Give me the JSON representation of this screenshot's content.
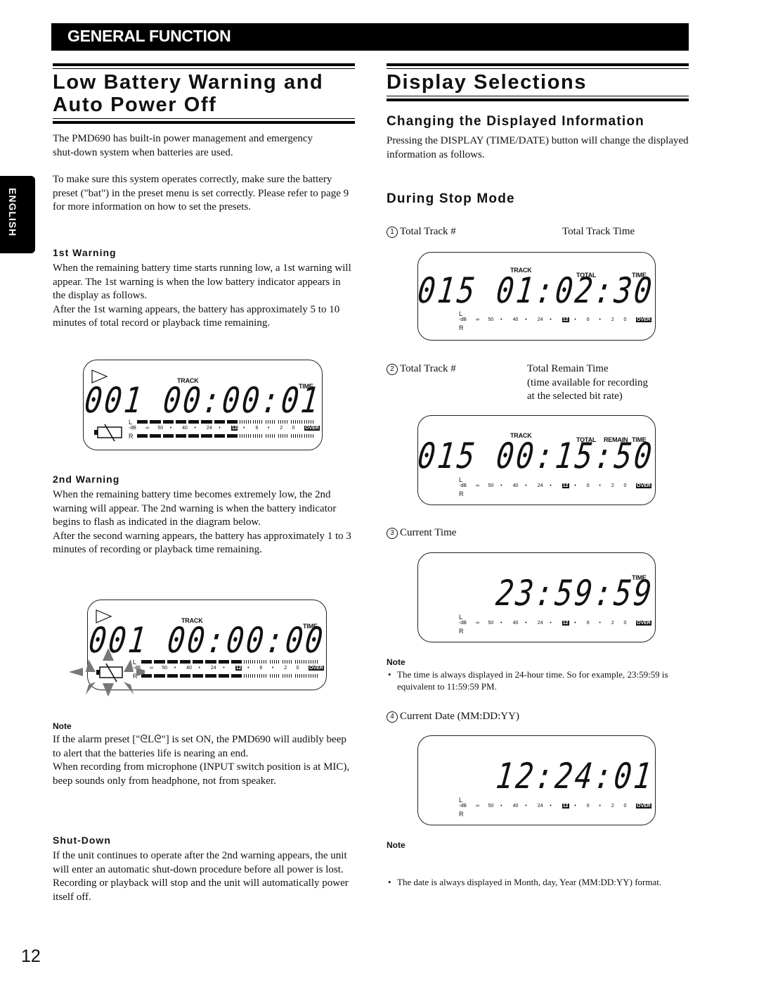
{
  "header": {
    "banner": "GENERAL FUNCTION"
  },
  "side_tab": {
    "label": "ENGLISH"
  },
  "page_number": "12",
  "left": {
    "title_line1": "Low Battery Warning and",
    "title_line2": "Auto Power Off",
    "intro1": "The PMD690 has built-in power management and emergency shut-down system when batteries are used.",
    "intro2": "To make sure this system operates correctly, make sure the battery preset (\"bat\") in the preset menu is set correctly.  Please refer to page 9 for more information on how to set the presets.",
    "first_warning": {
      "heading": "1st Warning",
      "text": "When the remaining battery time starts running low, a 1st warning will appear.  The 1st warning is when the low battery indicator appears in the display as follows.",
      "text2": "After the 1st warning appears, the battery has approximately 5 to 10 minutes of total record or playback time remaining."
    },
    "second_warning": {
      "heading": "2nd Warning",
      "text": "When the remaining battery time becomes extremely low, the 2nd warning will appear. The 2nd warning is when the battery indicator begins to flash as indicated in the diagram below.",
      "text2": "After the second warning appears, the battery has approximately 1 to 3 minutes of recording or playback time remaining."
    },
    "note": {
      "heading": "Note",
      "text": "If the alarm preset [\"ᘓLᘓ\"] is set ON, the PMD690 will audibly beep to alert that the batteries life is nearing an end.",
      "text2": "When recording from microphone (INPUT switch position is at MIC), beep sounds only from headphone, not from speaker."
    },
    "shutdown": {
      "heading": "Shut-Down",
      "text": "If the unit continues to operate after the 2nd warning appears, the unit will enter an automatic shut-down procedure before all power is lost.  Recording or playback will stop and the unit will automatically power itself off."
    }
  },
  "right": {
    "title": "Display Selections",
    "subtitle": "Changing the Displayed Information",
    "intro": "Pressing the DISPLAY (TIME/DATE) button will change the displayed information as follows.",
    "mode_heading": "During Stop Mode",
    "items": [
      {
        "num": "1",
        "label": "Total Track #",
        "desc": "Total Track Time"
      },
      {
        "num": "2",
        "label": "Total Track #",
        "desc": "Total Remain Time",
        "desc2": "(time available for recording",
        "desc3": "at the selected bit rate)"
      },
      {
        "num": "3",
        "label": "Current Time"
      },
      {
        "num": "4",
        "label": "Current Date (MM:DD:YY)"
      }
    ],
    "note1": {
      "heading": "Note",
      "text": "The time is always displayed in 24-hour time. So for example, 23:59:59 is equivalent to 11:59:59 PM."
    },
    "note2": {
      "heading": "Note",
      "text": "The date is always displayed in Month, day, Year (MM:DD:YY) format."
    }
  },
  "lcd": {
    "meter_labels": [
      "∞",
      "50",
      "•",
      "40",
      "•",
      "24",
      "•",
      "12",
      "•",
      "6",
      "•",
      "2",
      "0",
      "OVER"
    ],
    "db_label": "-dB",
    "left_ch": "L",
    "right_ch": "R",
    "track_label": "TRACK",
    "time_label": "TIME",
    "total_label": "TOTAL",
    "remain_label": "REMAIN",
    "warn1": {
      "track": "001",
      "time": "00:00:01"
    },
    "warn2": {
      "track": "001",
      "time": "00:00:00"
    },
    "d1": {
      "track": "015",
      "time": "01:02:30"
    },
    "d2": {
      "track": "015",
      "time": "00:15:50"
    },
    "d3": {
      "time": "23:59:59"
    },
    "d4": {
      "date": "12:24:01"
    }
  }
}
